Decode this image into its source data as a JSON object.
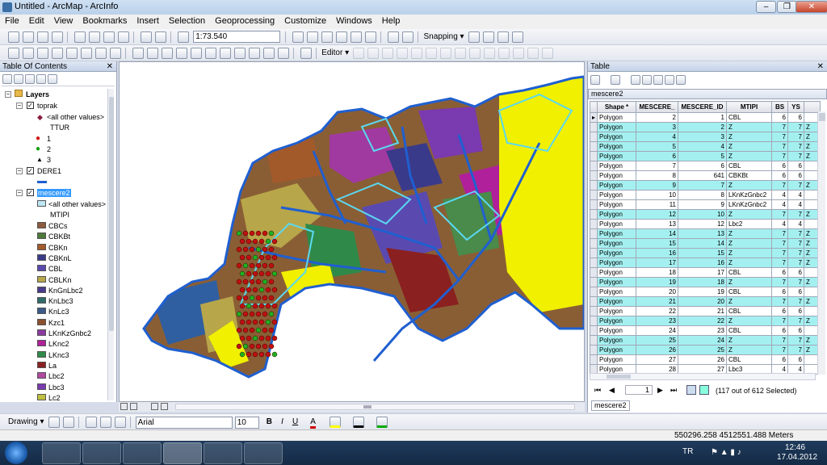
{
  "window": {
    "title": "Untitled - ArcMap - ArcInfo"
  },
  "menus": [
    "File",
    "Edit",
    "View",
    "Bookmarks",
    "Insert",
    "Selection",
    "Geoprocessing",
    "Customize",
    "Windows",
    "Help"
  ],
  "toolbar": {
    "scale": "1:73.540",
    "snapping_label": "Snapping ▾",
    "editor_label": "Editor ▾"
  },
  "toc": {
    "title": "Table Of Contents",
    "layers_label": "Layers",
    "toprak": {
      "name": "toprak",
      "other": "<all other values>",
      "field": "TTUR",
      "values": [
        "1",
        "2",
        "3"
      ]
    },
    "dere": {
      "name": "DERE1"
    },
    "mescere": {
      "name": "mescere2",
      "other": "<all other values>",
      "field": "MTIPI",
      "classes": [
        {
          "label": "CBCs",
          "color": "#8c5a3c"
        },
        {
          "label": "CBKBt",
          "color": "#4d7a3a"
        },
        {
          "label": "CBKn",
          "color": "#a35a2a"
        },
        {
          "label": "CBKnL",
          "color": "#3a3a8a"
        },
        {
          "label": "CBL",
          "color": "#5a4ab0"
        },
        {
          "label": "CBLKn",
          "color": "#b8a64a"
        },
        {
          "label": "KnGnLbc2",
          "color": "#4a3a8c"
        },
        {
          "label": "KnLbc3",
          "color": "#2f6b6b"
        },
        {
          "label": "KnLc3",
          "color": "#3b5a8a"
        },
        {
          "label": "Kzc1",
          "color": "#8a5030"
        },
        {
          "label": "LKnKzGnbc2",
          "color": "#8a3aa0"
        },
        {
          "label": "LKnc2",
          "color": "#b0209a"
        },
        {
          "label": "LKnc3",
          "color": "#2f8a4a"
        },
        {
          "label": "La",
          "color": "#8a2020"
        },
        {
          "label": "Lbc2",
          "color": "#b04aa0"
        },
        {
          "label": "Lbc3",
          "color": "#7a3ab0"
        },
        {
          "label": "Lc2",
          "color": "#c0c040"
        }
      ]
    }
  },
  "table": {
    "title": "Table",
    "layer": "mescere2",
    "columns": [
      "",
      "Shape *",
      "MESCERE_",
      "MESCERE_ID",
      "MTIPI",
      "BS",
      "YS",
      ""
    ],
    "rows": [
      [
        "Polygon",
        "2",
        "1",
        "CBL",
        "6",
        "6",
        ""
      ],
      [
        "Polygon",
        "3",
        "2",
        "Z",
        "7",
        "7",
        "Z"
      ],
      [
        "Polygon",
        "4",
        "3",
        "Z",
        "7",
        "7",
        "Z"
      ],
      [
        "Polygon",
        "5",
        "4",
        "Z",
        "7",
        "7",
        "Z"
      ],
      [
        "Polygon",
        "6",
        "5",
        "Z",
        "7",
        "7",
        "Z"
      ],
      [
        "Polygon",
        "7",
        "6",
        "CBL",
        "6",
        "6",
        ""
      ],
      [
        "Polygon",
        "8",
        "641",
        "CBKBt",
        "6",
        "6",
        ""
      ],
      [
        "Polygon",
        "9",
        "7",
        "Z",
        "7",
        "7",
        "Z"
      ],
      [
        "Polygon",
        "10",
        "8",
        "LKnKzGnbc2",
        "4",
        "4",
        ""
      ],
      [
        "Polygon",
        "11",
        "9",
        "LKnKzGnbc2",
        "4",
        "4",
        ""
      ],
      [
        "Polygon",
        "12",
        "10",
        "Z",
        "7",
        "7",
        "Z"
      ],
      [
        "Polygon",
        "13",
        "12",
        "Lbc2",
        "4",
        "4",
        ""
      ],
      [
        "Polygon",
        "14",
        "13",
        "Z",
        "7",
        "7",
        "Z"
      ],
      [
        "Polygon",
        "15",
        "14",
        "Z",
        "7",
        "7",
        "Z"
      ],
      [
        "Polygon",
        "16",
        "15",
        "Z",
        "7",
        "7",
        "Z"
      ],
      [
        "Polygon",
        "17",
        "16",
        "Z",
        "7",
        "7",
        "Z"
      ],
      [
        "Polygon",
        "18",
        "17",
        "CBL",
        "6",
        "6",
        ""
      ],
      [
        "Polygon",
        "19",
        "18",
        "Z",
        "7",
        "7",
        "Z"
      ],
      [
        "Polygon",
        "20",
        "19",
        "CBL",
        "6",
        "6",
        ""
      ],
      [
        "Polygon",
        "21",
        "20",
        "Z",
        "7",
        "7",
        "Z"
      ],
      [
        "Polygon",
        "22",
        "21",
        "CBL",
        "6",
        "6",
        ""
      ],
      [
        "Polygon",
        "23",
        "22",
        "Z",
        "7",
        "7",
        "Z"
      ],
      [
        "Polygon",
        "24",
        "23",
        "CBL",
        "6",
        "6",
        ""
      ],
      [
        "Polygon",
        "25",
        "24",
        "Z",
        "7",
        "7",
        "Z"
      ],
      [
        "Polygon",
        "26",
        "25",
        "Z",
        "7",
        "7",
        "Z"
      ],
      [
        "Polygon",
        "27",
        "26",
        "CBL",
        "6",
        "6",
        ""
      ],
      [
        "Polygon",
        "28",
        "27",
        "Lbc3",
        "4",
        "4",
        ""
      ]
    ],
    "selected_rows": [
      1,
      2,
      3,
      4,
      7,
      10,
      12,
      13,
      14,
      15,
      17,
      19,
      21,
      23,
      24
    ],
    "record": "1",
    "selection_status": "(117 out of 612 Selected)"
  },
  "drawing": {
    "label": "Drawing ▾",
    "font": "Arial",
    "size": "10"
  },
  "status": {
    "coords": "550296.258  4512551.488 Meters"
  },
  "taskbar": {
    "lang": "TR",
    "time": "12:46",
    "date": "17.04.2012"
  }
}
